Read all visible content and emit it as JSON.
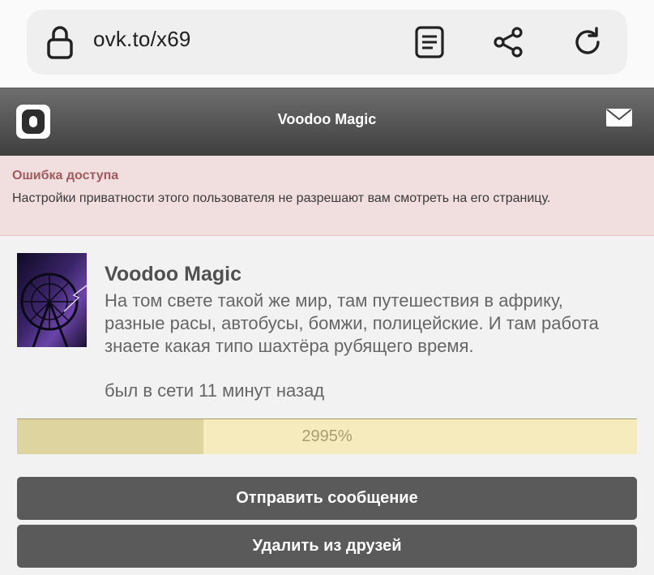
{
  "browser": {
    "url": "ovk.to/x69",
    "icons": [
      "lock-icon",
      "reader-mode-icon",
      "share-icon",
      "reload-icon"
    ]
  },
  "header": {
    "title": "Voodoo Magic",
    "logo_icon": "openvk-logo",
    "mail_icon": "mail-icon"
  },
  "error": {
    "title": "Ошибка доступа",
    "message": "Настройки приватности этого пользователя не разрешают вам смотреть на его страницу."
  },
  "profile": {
    "name": "Voodoo Magic",
    "status": "На том свете такой же мир, там путешествия в африку, разные расы, автобусы, бомжи, полицейские. И там работа знаете какая типо шахтёра рубящего время.",
    "online": "был в сети 11 минут назад"
  },
  "progress": {
    "label": "2995%",
    "fill_fraction": 0.3
  },
  "actions": {
    "send_message": "Отправить сообщение",
    "remove_friend": "Удалить из друзей"
  },
  "colors": {
    "header_top": "#6e6e6e",
    "header_bottom": "#3f3f3f",
    "error_bg": "#f1dedf",
    "error_title": "#a15a5e",
    "progress_bg": "#f6ebbc",
    "progress_fill": "#ded4a0",
    "button_bg": "#5a5a5a"
  }
}
